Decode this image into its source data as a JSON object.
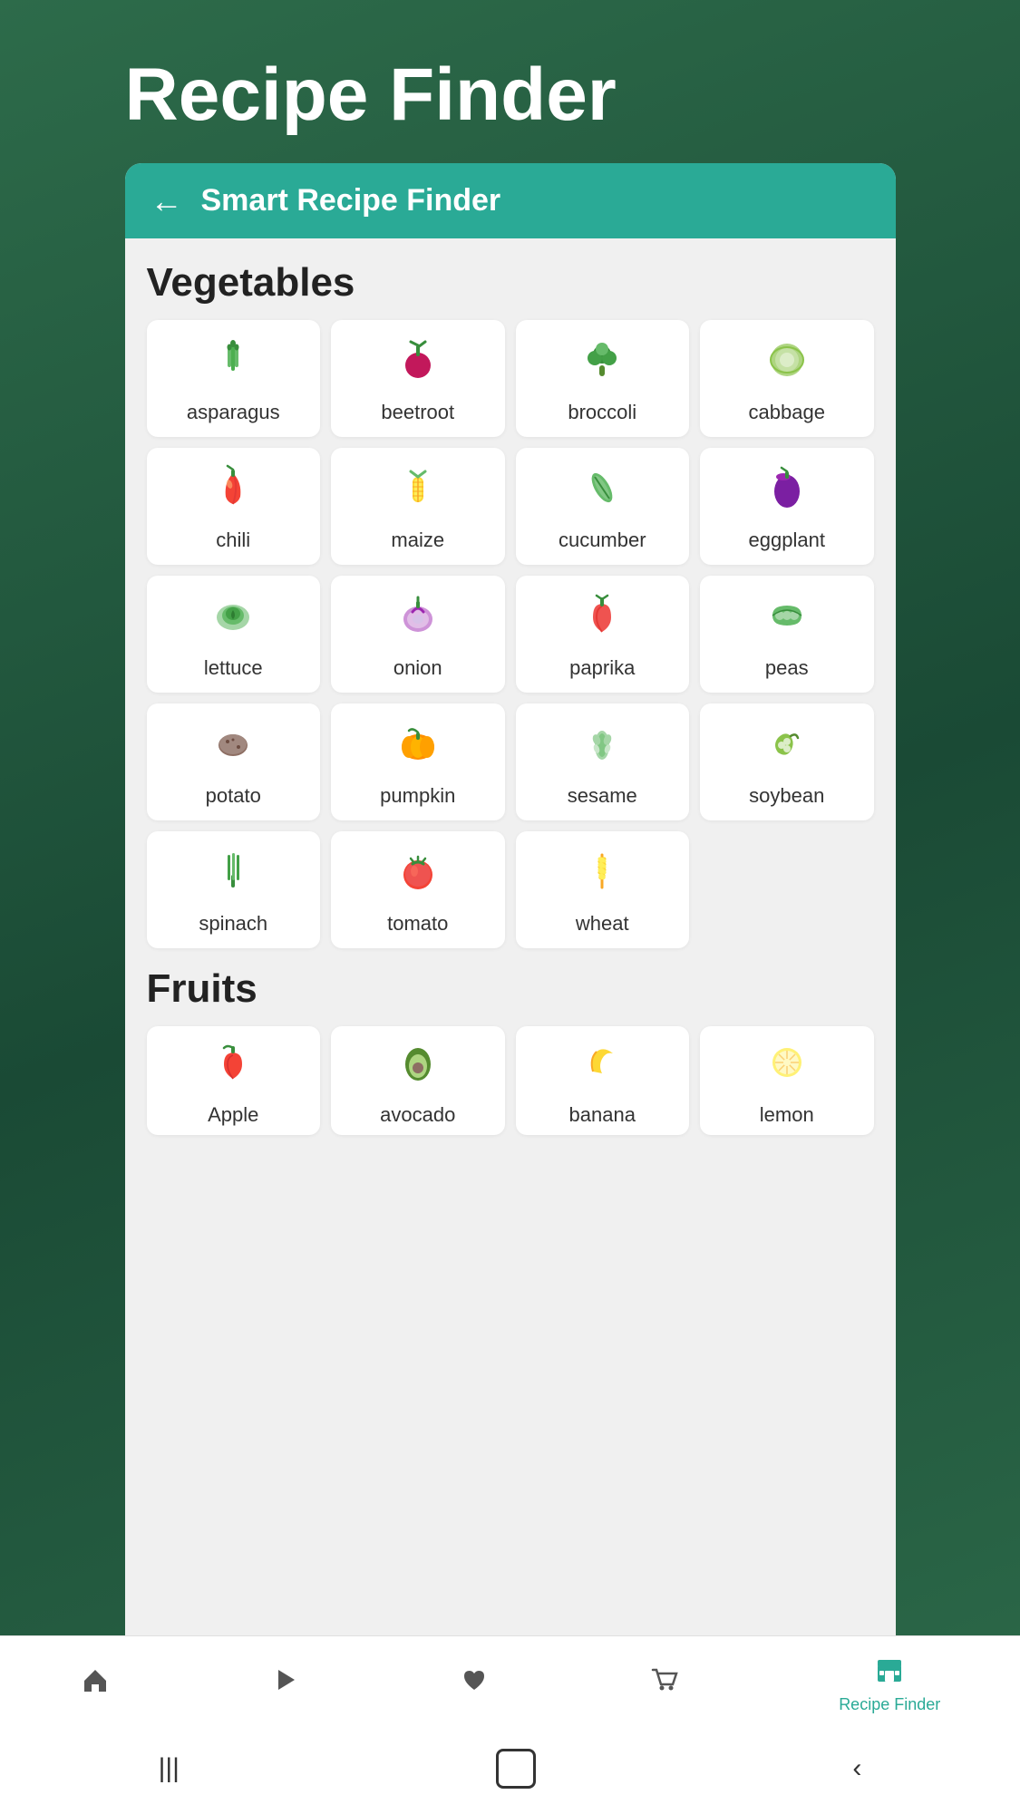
{
  "app": {
    "title": "Recipe Finder",
    "header": {
      "back_label": "←",
      "title": "Smart Recipe Finder"
    }
  },
  "vegetables": {
    "section_title": "Vegetables",
    "items": [
      {
        "id": "asparagus",
        "label": "asparagus",
        "icon": "🥦",
        "emoji": "🌿"
      },
      {
        "id": "beetroot",
        "label": "beetroot",
        "icon": "🫚"
      },
      {
        "id": "broccoli",
        "label": "broccoli",
        "icon": "🥦"
      },
      {
        "id": "cabbage",
        "label": "cabbage",
        "icon": "🥬"
      },
      {
        "id": "chili",
        "label": "chili",
        "icon": "🌶️"
      },
      {
        "id": "maize",
        "label": "maize",
        "icon": "🌽"
      },
      {
        "id": "cucumber",
        "label": "cucumber",
        "icon": "🥒"
      },
      {
        "id": "eggplant",
        "label": "eggplant",
        "icon": "🍆"
      },
      {
        "id": "lettuce",
        "label": "lettuce",
        "icon": "🥬"
      },
      {
        "id": "onion",
        "label": "onion",
        "icon": "🧅"
      },
      {
        "id": "paprika",
        "label": "paprika",
        "icon": "🫑"
      },
      {
        "id": "peas",
        "label": "peas",
        "icon": "🫘"
      },
      {
        "id": "potato",
        "label": "potato",
        "icon": "🥔"
      },
      {
        "id": "pumpkin",
        "label": "pumpkin",
        "icon": "🎃"
      },
      {
        "id": "sesame",
        "label": "sesame",
        "icon": "🌿"
      },
      {
        "id": "soybean",
        "label": "soybean",
        "icon": "🫘"
      },
      {
        "id": "spinach",
        "label": "spinach",
        "icon": "🌿"
      },
      {
        "id": "tomato",
        "label": "tomato",
        "icon": "🍅"
      },
      {
        "id": "wheat",
        "label": "wheat",
        "icon": "🌾"
      }
    ]
  },
  "fruits": {
    "section_title": "Fruits",
    "items": [
      {
        "id": "apple",
        "label": "Apple",
        "icon": "🍎"
      },
      {
        "id": "avocado",
        "label": "avocado",
        "icon": "🥑"
      },
      {
        "id": "banana",
        "label": "banana",
        "icon": "🍌"
      },
      {
        "id": "lemon",
        "label": "lemon",
        "icon": "🍋"
      }
    ]
  },
  "nav": {
    "items": [
      {
        "id": "home",
        "icon": "🏠",
        "label": "",
        "active": false
      },
      {
        "id": "play",
        "icon": "▶",
        "label": "",
        "active": false
      },
      {
        "id": "heart",
        "icon": "♥",
        "label": "",
        "active": false
      },
      {
        "id": "cart",
        "icon": "🛒",
        "label": "",
        "active": false
      },
      {
        "id": "recipe",
        "icon": "🏪",
        "label": "Recipe Finder",
        "active": true
      }
    ]
  }
}
